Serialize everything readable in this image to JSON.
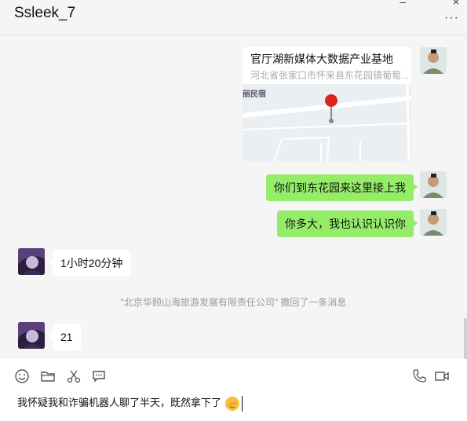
{
  "header": {
    "title": "Ssleek_7",
    "more_label": "···",
    "minimize_label": "–",
    "close_label": "×"
  },
  "messages": {
    "location": {
      "title": "官厅湖新媒体大数据产业基地",
      "address": "河北省张家口市怀来县东花园镇葡萄...",
      "map_label": "丽民宿"
    },
    "me_1": "你们到东花园来这里接上我",
    "me_2": "你多大，我也认识认识你",
    "other_1": "1小时20分钟",
    "recall_notice": "\"北京华颐山海旅游发展有限责任公司\" 撤回了一条消息",
    "other_2": "21"
  },
  "input": {
    "draft": "我怀疑我和诈骗机器人聊了半天，既然拿下了"
  },
  "icons": {
    "toolbar_left": [
      "emoji-icon",
      "folder-icon",
      "scissors-icon",
      "chat-bubble-icon"
    ],
    "toolbar_right": [
      "phone-icon",
      "video-icon"
    ]
  },
  "colors": {
    "my_bubble": "#95ec69",
    "other_bubble": "#ffffff",
    "background": "#f5f5f5",
    "pin": "#e02020"
  }
}
